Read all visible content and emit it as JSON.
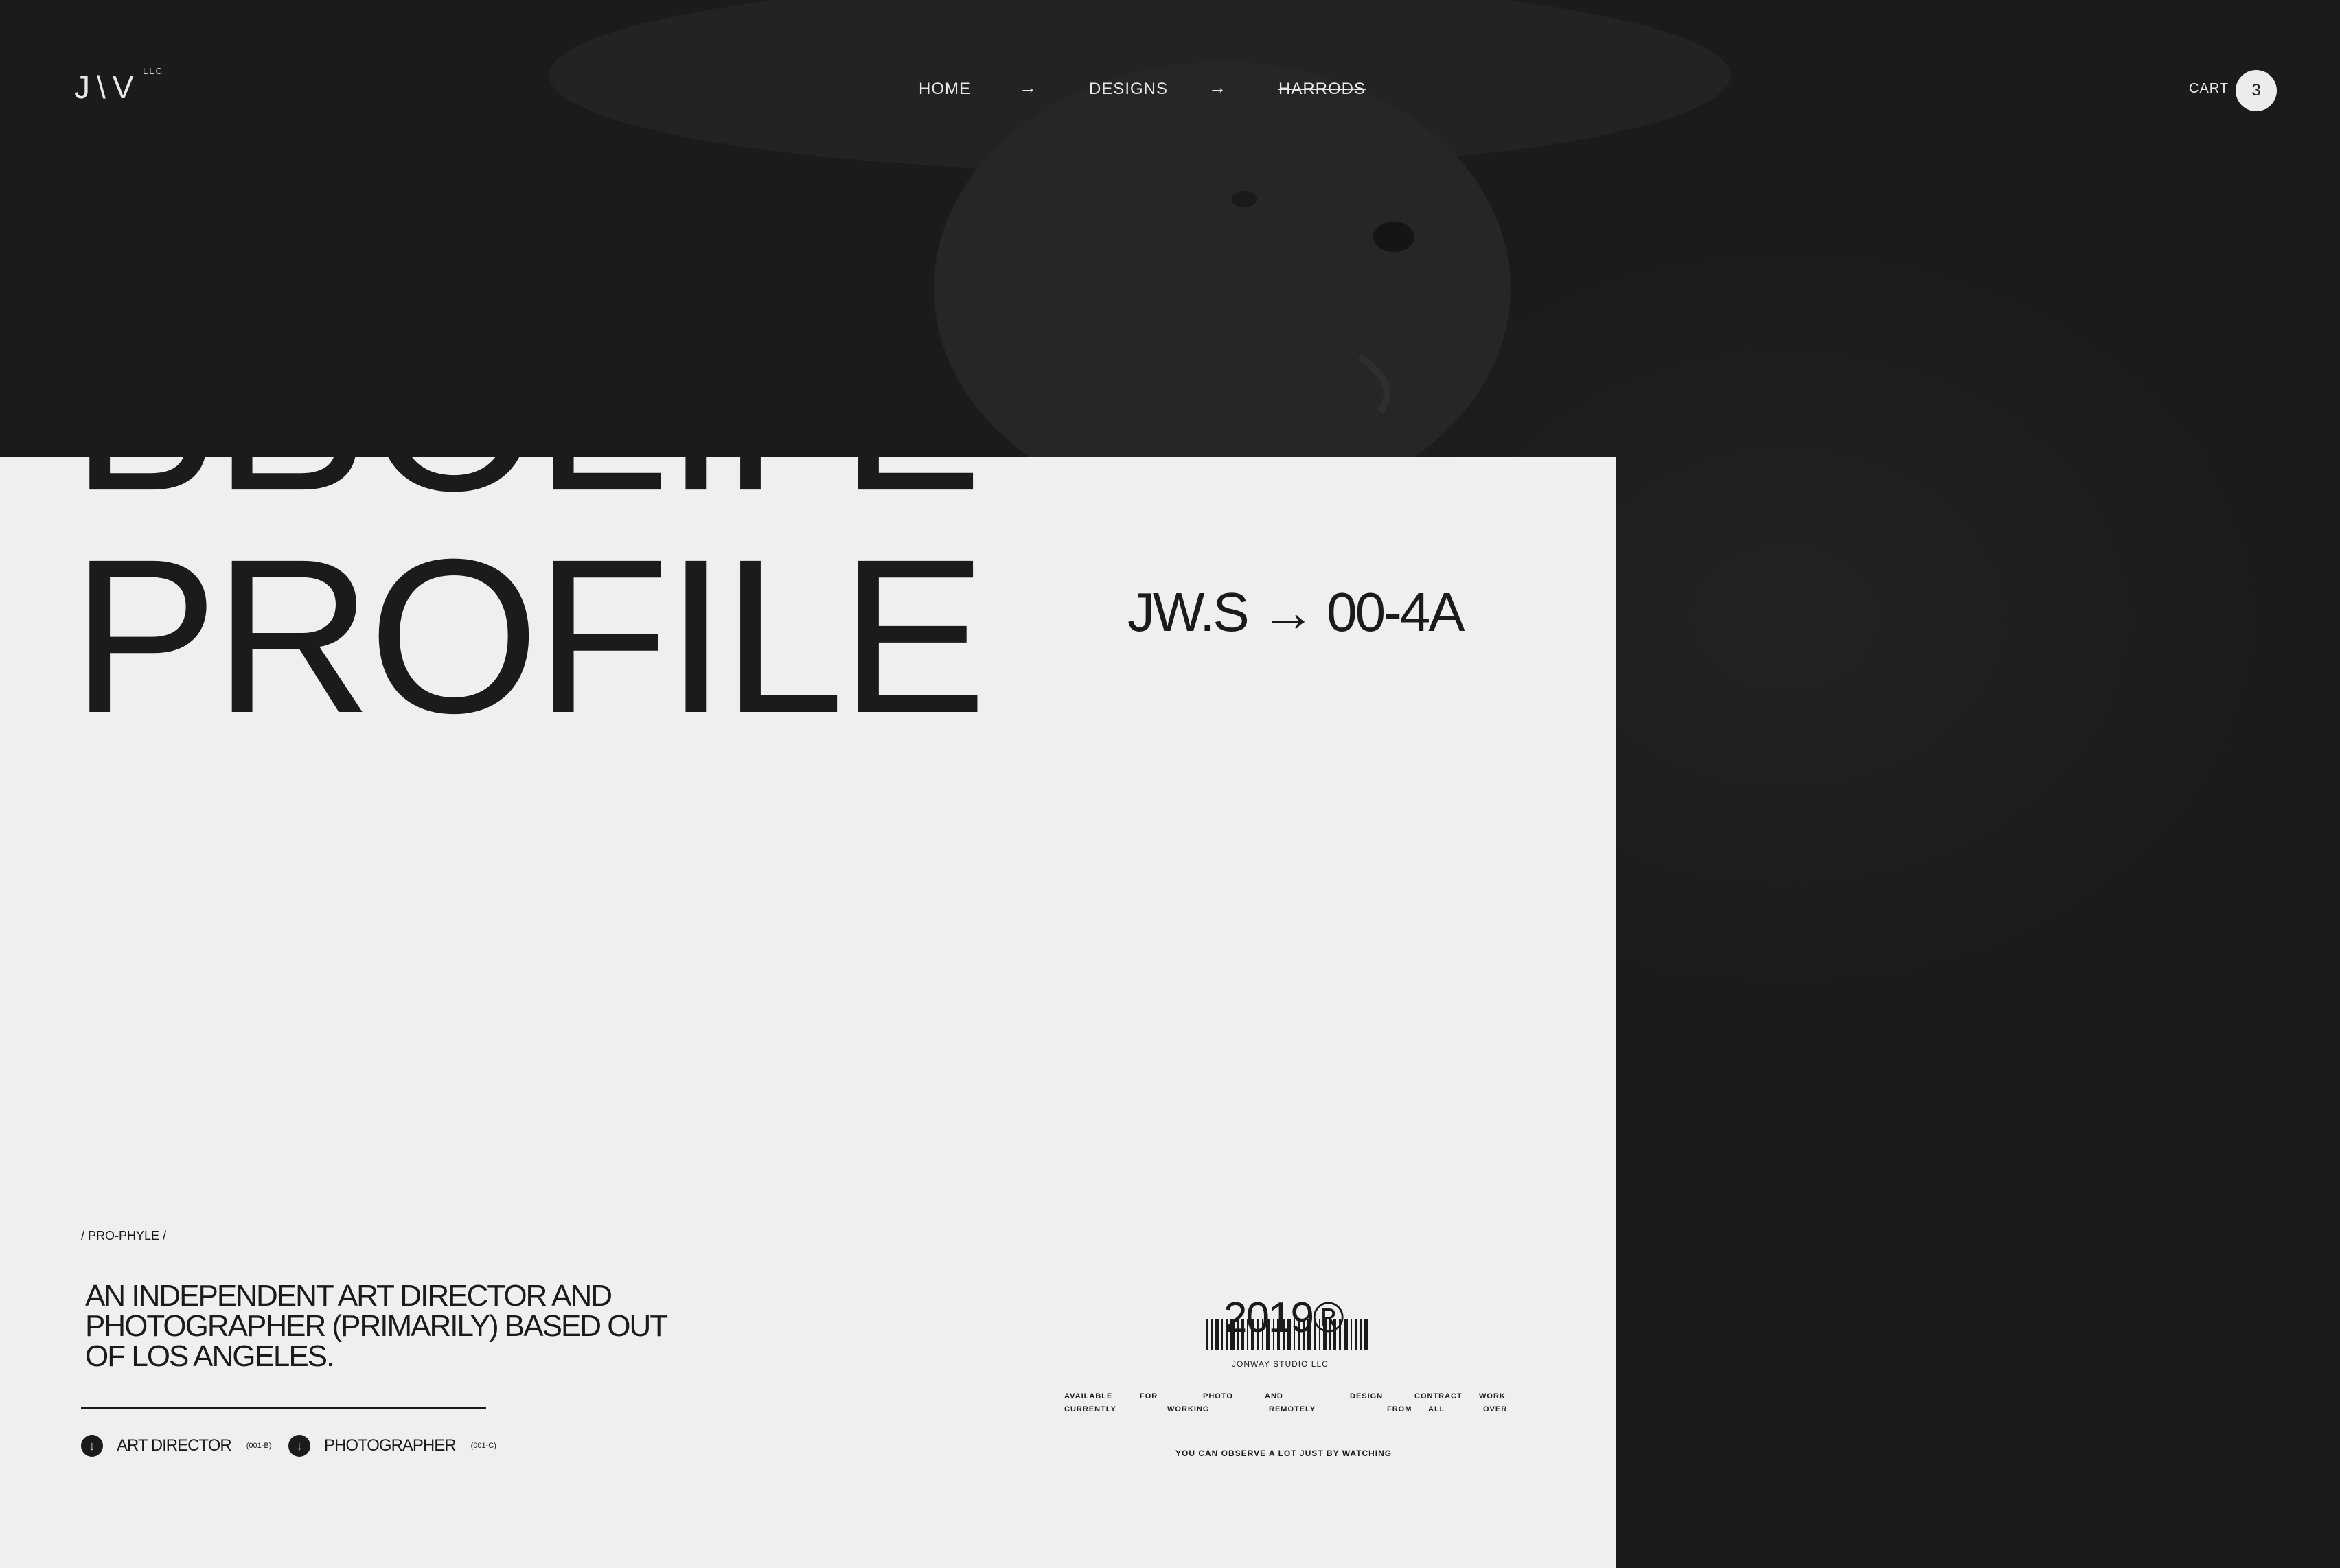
{
  "brand": {
    "logo": "J\\V",
    "suffix": "LLC"
  },
  "nav": {
    "items": [
      {
        "label": "HOME"
      },
      {
        "label": "DESIGNS"
      },
      {
        "label": "HARRODS"
      }
    ],
    "separator": "→"
  },
  "cart": {
    "label": "CART",
    "count": "3"
  },
  "hero": {
    "title": "PROFILE",
    "title_mirror": "PROFILE",
    "code": "JW.S → 00-4A"
  },
  "about": {
    "slug": "/ PRO-PHYLE /",
    "description": "AN INDEPENDENT ART DIRECTOR AND PHOTOGRAPHER (PRIMARILY) BASED OUT OF LOS ANGELES.",
    "roles": [
      {
        "label": "ART DIRECTOR",
        "code": "(001-B)"
      },
      {
        "label": "PHOTOGRAPHER",
        "code": "(001-C)"
      }
    ]
  },
  "stamp": {
    "year": "2019®",
    "studio": "JONWAY STUDIO LLC",
    "availability_words": [
      "AVAILABLE",
      "FOR",
      "PHOTO",
      "AND",
      "DESIGN",
      "CONTRACT",
      "WORK",
      "CURRENTLY",
      "WORKING",
      "REMOTELY",
      "FROM",
      "ALL",
      "OVER"
    ],
    "motto": "YOU CAN OBSERVE A LOT JUST BY WATCHING"
  },
  "icons": {
    "arrow": "arrow-right-icon",
    "role": "arrow-down-circle-icon"
  }
}
